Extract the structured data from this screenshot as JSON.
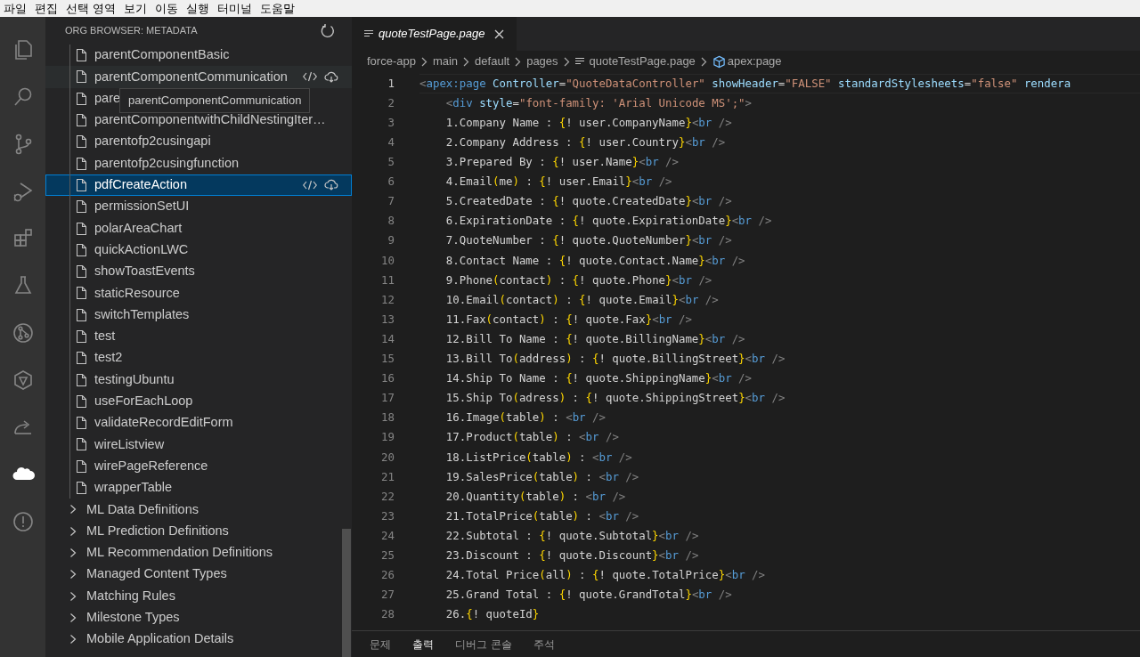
{
  "menu_bar": [
    "파일",
    "편집",
    "선택 영역",
    "보기",
    "이동",
    "실행",
    "터미널",
    "도움말"
  ],
  "activity_bar": [
    {
      "selected": false
    },
    {
      "selected": false
    },
    {
      "selected": false
    },
    {
      "selected": false
    },
    {
      "selected": false
    },
    {
      "selected": false
    },
    {
      "selected": false
    },
    {
      "selected": false
    },
    {
      "selected": false
    },
    {
      "selected": true
    },
    {
      "selected": false
    }
  ],
  "sidebar": {
    "title": "ORG BROWSER: METADATA",
    "items": [
      {
        "label": "parentComponentBasic",
        "kind": "file",
        "selected": false,
        "hovered": false
      },
      {
        "label": "parentComponentCommunication",
        "kind": "file",
        "selected": false,
        "hovered": true
      },
      {
        "label": "pare",
        "kind": "file",
        "selected": false,
        "hovered": false
      },
      {
        "label": "parentComponentwithChildNestingIter…",
        "kind": "file",
        "selected": false,
        "hovered": false
      },
      {
        "label": "parentofp2cusingapi",
        "kind": "file",
        "selected": false,
        "hovered": false
      },
      {
        "label": "parentofp2cusingfunction",
        "kind": "file",
        "selected": false,
        "hovered": false
      },
      {
        "label": "pdfCreateAction",
        "kind": "file",
        "selected": true,
        "hovered": false
      },
      {
        "label": "permissionSetUI",
        "kind": "file",
        "selected": false,
        "hovered": false
      },
      {
        "label": "polarAreaChart",
        "kind": "file",
        "selected": false,
        "hovered": false
      },
      {
        "label": "quickActionLWC",
        "kind": "file",
        "selected": false,
        "hovered": false
      },
      {
        "label": "showToastEvents",
        "kind": "file",
        "selected": false,
        "hovered": false
      },
      {
        "label": "staticResource",
        "kind": "file",
        "selected": false,
        "hovered": false
      },
      {
        "label": "switchTemplates",
        "kind": "file",
        "selected": false,
        "hovered": false
      },
      {
        "label": "test",
        "kind": "file",
        "selected": false,
        "hovered": false
      },
      {
        "label": "test2",
        "kind": "file",
        "selected": false,
        "hovered": false
      },
      {
        "label": "testingUbuntu",
        "kind": "file",
        "selected": false,
        "hovered": false
      },
      {
        "label": "useForEachLoop",
        "kind": "file",
        "selected": false,
        "hovered": false
      },
      {
        "label": "validateRecordEditForm",
        "kind": "file",
        "selected": false,
        "hovered": false
      },
      {
        "label": "wireListview",
        "kind": "file",
        "selected": false,
        "hovered": false
      },
      {
        "label": "wirePageReference",
        "kind": "file",
        "selected": false,
        "hovered": false
      },
      {
        "label": "wrapperTable",
        "kind": "file",
        "selected": false,
        "hovered": false
      },
      {
        "label": "ML Data Definitions",
        "kind": "folder",
        "selected": false,
        "hovered": false
      },
      {
        "label": "ML Prediction Definitions",
        "kind": "folder",
        "selected": false,
        "hovered": false
      },
      {
        "label": "ML Recommendation Definitions",
        "kind": "folder",
        "selected": false,
        "hovered": false
      },
      {
        "label": "Managed Content Types",
        "kind": "folder",
        "selected": false,
        "hovered": false
      },
      {
        "label": "Matching Rules",
        "kind": "folder",
        "selected": false,
        "hovered": false
      },
      {
        "label": "Milestone Types",
        "kind": "folder",
        "selected": false,
        "hovered": false
      },
      {
        "label": "Mobile Application Details",
        "kind": "folder",
        "selected": false,
        "hovered": false
      }
    ],
    "tooltip": "parentComponentCommunication"
  },
  "editor": {
    "tab": {
      "title": "quoteTestPage.page",
      "selected": true
    },
    "breadcrumbs": [
      "force-app",
      "main",
      "default",
      "pages",
      "quoteTestPage.page",
      "apex:page"
    ],
    "lines": [
      {
        "number": "1",
        "current": true,
        "tokens": [
          {
            "kind": "punct",
            "text": "<"
          },
          {
            "kind": "tag",
            "text": "apex:page"
          },
          {
            "kind": "attr",
            "text": " Controller"
          },
          {
            "kind": "text",
            "text": "="
          },
          {
            "kind": "string",
            "text": "\"QuoteDataController\""
          },
          {
            "kind": "attr",
            "text": " showHeader"
          },
          {
            "kind": "text",
            "text": "="
          },
          {
            "kind": "string",
            "text": "\"FALSE\""
          },
          {
            "kind": "attr",
            "text": " standardStylesheets"
          },
          {
            "kind": "text",
            "text": "="
          },
          {
            "kind": "string",
            "text": "\"false\""
          },
          {
            "kind": "attr",
            "text": " rendera"
          }
        ]
      },
      {
        "number": "2",
        "current": false,
        "tokens": [
          {
            "kind": "punct",
            "text": "    <"
          },
          {
            "kind": "tag",
            "text": "div"
          },
          {
            "kind": "attr",
            "text": " style"
          },
          {
            "kind": "text",
            "text": "="
          },
          {
            "kind": "string",
            "text": "\"font-family: 'Arial Unicode MS';\""
          },
          {
            "kind": "punct",
            "text": ">"
          }
        ]
      },
      {
        "number": "3",
        "current": false,
        "tokens": [
          {
            "kind": "text",
            "text": "    1.Company Name : "
          },
          {
            "kind": "brace",
            "text": "{"
          },
          {
            "kind": "text",
            "text": "! user.CompanyName"
          },
          {
            "kind": "brace",
            "text": "}"
          },
          {
            "kind": "punct",
            "text": "<"
          },
          {
            "kind": "tag",
            "text": "br"
          },
          {
            "kind": "punct",
            "text": " />"
          }
        ]
      },
      {
        "number": "4",
        "current": false,
        "tokens": [
          {
            "kind": "text",
            "text": "    2.Company Address : "
          },
          {
            "kind": "brace",
            "text": "{"
          },
          {
            "kind": "text",
            "text": "! user.Country"
          },
          {
            "kind": "brace",
            "text": "}"
          },
          {
            "kind": "punct",
            "text": "<"
          },
          {
            "kind": "tag",
            "text": "br"
          },
          {
            "kind": "punct",
            "text": " />"
          }
        ]
      },
      {
        "number": "5",
        "current": false,
        "tokens": [
          {
            "kind": "text",
            "text": "    3.Prepared By : "
          },
          {
            "kind": "brace",
            "text": "{"
          },
          {
            "kind": "text",
            "text": "! user.Name"
          },
          {
            "kind": "brace",
            "text": "}"
          },
          {
            "kind": "punct",
            "text": "<"
          },
          {
            "kind": "tag",
            "text": "br"
          },
          {
            "kind": "punct",
            "text": " />"
          }
        ]
      },
      {
        "number": "6",
        "current": false,
        "tokens": [
          {
            "kind": "text",
            "text": "    4.Email"
          },
          {
            "kind": "brace",
            "text": "("
          },
          {
            "kind": "text",
            "text": "me"
          },
          {
            "kind": "brace",
            "text": ")"
          },
          {
            "kind": "text",
            "text": " : "
          },
          {
            "kind": "brace",
            "text": "{"
          },
          {
            "kind": "text",
            "text": "! user.Email"
          },
          {
            "kind": "brace",
            "text": "}"
          },
          {
            "kind": "punct",
            "text": "<"
          },
          {
            "kind": "tag",
            "text": "br"
          },
          {
            "kind": "punct",
            "text": " />"
          }
        ]
      },
      {
        "number": "7",
        "current": false,
        "tokens": [
          {
            "kind": "text",
            "text": "    5.CreatedDate : "
          },
          {
            "kind": "brace",
            "text": "{"
          },
          {
            "kind": "text",
            "text": "! quote.CreatedDate"
          },
          {
            "kind": "brace",
            "text": "}"
          },
          {
            "kind": "punct",
            "text": "<"
          },
          {
            "kind": "tag",
            "text": "br"
          },
          {
            "kind": "punct",
            "text": " />"
          }
        ]
      },
      {
        "number": "8",
        "current": false,
        "tokens": [
          {
            "kind": "text",
            "text": "    6.ExpirationDate : "
          },
          {
            "kind": "brace",
            "text": "{"
          },
          {
            "kind": "text",
            "text": "! quote.ExpirationDate"
          },
          {
            "kind": "brace",
            "text": "}"
          },
          {
            "kind": "punct",
            "text": "<"
          },
          {
            "kind": "tag",
            "text": "br"
          },
          {
            "kind": "punct",
            "text": " />"
          }
        ]
      },
      {
        "number": "9",
        "current": false,
        "tokens": [
          {
            "kind": "text",
            "text": "    7.QuoteNumber : "
          },
          {
            "kind": "brace",
            "text": "{"
          },
          {
            "kind": "text",
            "text": "! quote.QuoteNumber"
          },
          {
            "kind": "brace",
            "text": "}"
          },
          {
            "kind": "punct",
            "text": "<"
          },
          {
            "kind": "tag",
            "text": "br"
          },
          {
            "kind": "punct",
            "text": " />"
          }
        ]
      },
      {
        "number": "10",
        "current": false,
        "tokens": [
          {
            "kind": "text",
            "text": "    8.Contact Name : "
          },
          {
            "kind": "brace",
            "text": "{"
          },
          {
            "kind": "text",
            "text": "! quote.Contact.Name"
          },
          {
            "kind": "brace",
            "text": "}"
          },
          {
            "kind": "punct",
            "text": "<"
          },
          {
            "kind": "tag",
            "text": "br"
          },
          {
            "kind": "punct",
            "text": " />"
          }
        ]
      },
      {
        "number": "11",
        "current": false,
        "tokens": [
          {
            "kind": "text",
            "text": "    9.Phone"
          },
          {
            "kind": "brace",
            "text": "("
          },
          {
            "kind": "text",
            "text": "contact"
          },
          {
            "kind": "brace",
            "text": ")"
          },
          {
            "kind": "text",
            "text": " : "
          },
          {
            "kind": "brace",
            "text": "{"
          },
          {
            "kind": "text",
            "text": "! quote.Phone"
          },
          {
            "kind": "brace",
            "text": "}"
          },
          {
            "kind": "punct",
            "text": "<"
          },
          {
            "kind": "tag",
            "text": "br"
          },
          {
            "kind": "punct",
            "text": " />"
          }
        ]
      },
      {
        "number": "12",
        "current": false,
        "tokens": [
          {
            "kind": "text",
            "text": "    10.Email"
          },
          {
            "kind": "brace",
            "text": "("
          },
          {
            "kind": "text",
            "text": "contact"
          },
          {
            "kind": "brace",
            "text": ")"
          },
          {
            "kind": "text",
            "text": " : "
          },
          {
            "kind": "brace",
            "text": "{"
          },
          {
            "kind": "text",
            "text": "! quote.Email"
          },
          {
            "kind": "brace",
            "text": "}"
          },
          {
            "kind": "punct",
            "text": "<"
          },
          {
            "kind": "tag",
            "text": "br"
          },
          {
            "kind": "punct",
            "text": " />"
          }
        ]
      },
      {
        "number": "13",
        "current": false,
        "tokens": [
          {
            "kind": "text",
            "text": "    11.Fax"
          },
          {
            "kind": "brace",
            "text": "("
          },
          {
            "kind": "text",
            "text": "contact"
          },
          {
            "kind": "brace",
            "text": ")"
          },
          {
            "kind": "text",
            "text": " : "
          },
          {
            "kind": "brace",
            "text": "{"
          },
          {
            "kind": "text",
            "text": "! quote.Fax"
          },
          {
            "kind": "brace",
            "text": "}"
          },
          {
            "kind": "punct",
            "text": "<"
          },
          {
            "kind": "tag",
            "text": "br"
          },
          {
            "kind": "punct",
            "text": " />"
          }
        ]
      },
      {
        "number": "14",
        "current": false,
        "tokens": [
          {
            "kind": "text",
            "text": "    12.Bill To Name : "
          },
          {
            "kind": "brace",
            "text": "{"
          },
          {
            "kind": "text",
            "text": "! quote.BillingName"
          },
          {
            "kind": "brace",
            "text": "}"
          },
          {
            "kind": "punct",
            "text": "<"
          },
          {
            "kind": "tag",
            "text": "br"
          },
          {
            "kind": "punct",
            "text": " />"
          }
        ]
      },
      {
        "number": "15",
        "current": false,
        "tokens": [
          {
            "kind": "text",
            "text": "    13.Bill To"
          },
          {
            "kind": "brace",
            "text": "("
          },
          {
            "kind": "text",
            "text": "address"
          },
          {
            "kind": "brace",
            "text": ")"
          },
          {
            "kind": "text",
            "text": " : "
          },
          {
            "kind": "brace",
            "text": "{"
          },
          {
            "kind": "text",
            "text": "! quote.BillingStreet"
          },
          {
            "kind": "brace",
            "text": "}"
          },
          {
            "kind": "punct",
            "text": "<"
          },
          {
            "kind": "tag",
            "text": "br"
          },
          {
            "kind": "punct",
            "text": " />"
          }
        ]
      },
      {
        "number": "16",
        "current": false,
        "tokens": [
          {
            "kind": "text",
            "text": "    14.Ship To Name : "
          },
          {
            "kind": "brace",
            "text": "{"
          },
          {
            "kind": "text",
            "text": "! quote.ShippingName"
          },
          {
            "kind": "brace",
            "text": "}"
          },
          {
            "kind": "punct",
            "text": "<"
          },
          {
            "kind": "tag",
            "text": "br"
          },
          {
            "kind": "punct",
            "text": " />"
          }
        ]
      },
      {
        "number": "17",
        "current": false,
        "tokens": [
          {
            "kind": "text",
            "text": "    15.Ship To"
          },
          {
            "kind": "brace",
            "text": "("
          },
          {
            "kind": "text",
            "text": "adress"
          },
          {
            "kind": "brace",
            "text": ")"
          },
          {
            "kind": "text",
            "text": " : "
          },
          {
            "kind": "brace",
            "text": "{"
          },
          {
            "kind": "text",
            "text": "! quote.ShippingStreet"
          },
          {
            "kind": "brace",
            "text": "}"
          },
          {
            "kind": "punct",
            "text": "<"
          },
          {
            "kind": "tag",
            "text": "br"
          },
          {
            "kind": "punct",
            "text": " />"
          }
        ]
      },
      {
        "number": "18",
        "current": false,
        "tokens": [
          {
            "kind": "text",
            "text": "    16.Image"
          },
          {
            "kind": "brace",
            "text": "("
          },
          {
            "kind": "text",
            "text": "table"
          },
          {
            "kind": "brace",
            "text": ")"
          },
          {
            "kind": "text",
            "text": " : "
          },
          {
            "kind": "punct",
            "text": "<"
          },
          {
            "kind": "tag",
            "text": "br"
          },
          {
            "kind": "punct",
            "text": " />"
          }
        ]
      },
      {
        "number": "19",
        "current": false,
        "tokens": [
          {
            "kind": "text",
            "text": "    17.Product"
          },
          {
            "kind": "brace",
            "text": "("
          },
          {
            "kind": "text",
            "text": "table"
          },
          {
            "kind": "brace",
            "text": ")"
          },
          {
            "kind": "text",
            "text": " : "
          },
          {
            "kind": "punct",
            "text": "<"
          },
          {
            "kind": "tag",
            "text": "br"
          },
          {
            "kind": "punct",
            "text": " />"
          }
        ]
      },
      {
        "number": "20",
        "current": false,
        "tokens": [
          {
            "kind": "text",
            "text": "    18.ListPrice"
          },
          {
            "kind": "brace",
            "text": "("
          },
          {
            "kind": "text",
            "text": "table"
          },
          {
            "kind": "brace",
            "text": ")"
          },
          {
            "kind": "text",
            "text": " : "
          },
          {
            "kind": "punct",
            "text": "<"
          },
          {
            "kind": "tag",
            "text": "br"
          },
          {
            "kind": "punct",
            "text": " />"
          }
        ]
      },
      {
        "number": "21",
        "current": false,
        "tokens": [
          {
            "kind": "text",
            "text": "    19.SalesPrice"
          },
          {
            "kind": "brace",
            "text": "("
          },
          {
            "kind": "text",
            "text": "table"
          },
          {
            "kind": "brace",
            "text": ")"
          },
          {
            "kind": "text",
            "text": " : "
          },
          {
            "kind": "punct",
            "text": "<"
          },
          {
            "kind": "tag",
            "text": "br"
          },
          {
            "kind": "punct",
            "text": " />"
          }
        ]
      },
      {
        "number": "22",
        "current": false,
        "tokens": [
          {
            "kind": "text",
            "text": "    20.Quantity"
          },
          {
            "kind": "brace",
            "text": "("
          },
          {
            "kind": "text",
            "text": "table"
          },
          {
            "kind": "brace",
            "text": ")"
          },
          {
            "kind": "text",
            "text": " : "
          },
          {
            "kind": "punct",
            "text": "<"
          },
          {
            "kind": "tag",
            "text": "br"
          },
          {
            "kind": "punct",
            "text": " />"
          }
        ]
      },
      {
        "number": "23",
        "current": false,
        "tokens": [
          {
            "kind": "text",
            "text": "    21.TotalPrice"
          },
          {
            "kind": "brace",
            "text": "("
          },
          {
            "kind": "text",
            "text": "table"
          },
          {
            "kind": "brace",
            "text": ")"
          },
          {
            "kind": "text",
            "text": " : "
          },
          {
            "kind": "punct",
            "text": "<"
          },
          {
            "kind": "tag",
            "text": "br"
          },
          {
            "kind": "punct",
            "text": " />"
          }
        ]
      },
      {
        "number": "24",
        "current": false,
        "tokens": [
          {
            "kind": "text",
            "text": "    22.Subtotal : "
          },
          {
            "kind": "brace",
            "text": "{"
          },
          {
            "kind": "text",
            "text": "! quote.Subtotal"
          },
          {
            "kind": "brace",
            "text": "}"
          },
          {
            "kind": "punct",
            "text": "<"
          },
          {
            "kind": "tag",
            "text": "br"
          },
          {
            "kind": "punct",
            "text": " />"
          }
        ]
      },
      {
        "number": "25",
        "current": false,
        "tokens": [
          {
            "kind": "text",
            "text": "    23.Discount : "
          },
          {
            "kind": "brace",
            "text": "{"
          },
          {
            "kind": "text",
            "text": "! quote.Discount"
          },
          {
            "kind": "brace",
            "text": "}"
          },
          {
            "kind": "punct",
            "text": "<"
          },
          {
            "kind": "tag",
            "text": "br"
          },
          {
            "kind": "punct",
            "text": " />"
          }
        ]
      },
      {
        "number": "26",
        "current": false,
        "tokens": [
          {
            "kind": "text",
            "text": "    24.Total Price"
          },
          {
            "kind": "brace",
            "text": "("
          },
          {
            "kind": "text",
            "text": "all"
          },
          {
            "kind": "brace",
            "text": ")"
          },
          {
            "kind": "text",
            "text": " : "
          },
          {
            "kind": "brace",
            "text": "{"
          },
          {
            "kind": "text",
            "text": "! quote.TotalPrice"
          },
          {
            "kind": "brace",
            "text": "}"
          },
          {
            "kind": "punct",
            "text": "<"
          },
          {
            "kind": "tag",
            "text": "br"
          },
          {
            "kind": "punct",
            "text": " />"
          }
        ]
      },
      {
        "number": "27",
        "current": false,
        "tokens": [
          {
            "kind": "text",
            "text": "    25.Grand Total : "
          },
          {
            "kind": "brace",
            "text": "{"
          },
          {
            "kind": "text",
            "text": "! quote.GrandTotal"
          },
          {
            "kind": "brace",
            "text": "}"
          },
          {
            "kind": "punct",
            "text": "<"
          },
          {
            "kind": "tag",
            "text": "br"
          },
          {
            "kind": "punct",
            "text": " />"
          }
        ]
      },
      {
        "number": "28",
        "current": false,
        "tokens": [
          {
            "kind": "text",
            "text": "    26."
          },
          {
            "kind": "brace",
            "text": "{"
          },
          {
            "kind": "text",
            "text": "! quoteId"
          },
          {
            "kind": "brace",
            "text": "}"
          }
        ]
      }
    ]
  },
  "panel_tabs": [
    {
      "label": "문제",
      "selected": false
    },
    {
      "label": "출력",
      "selected": true
    },
    {
      "label": "디버그 콘솔",
      "selected": false
    },
    {
      "label": "주석",
      "selected": false
    }
  ]
}
